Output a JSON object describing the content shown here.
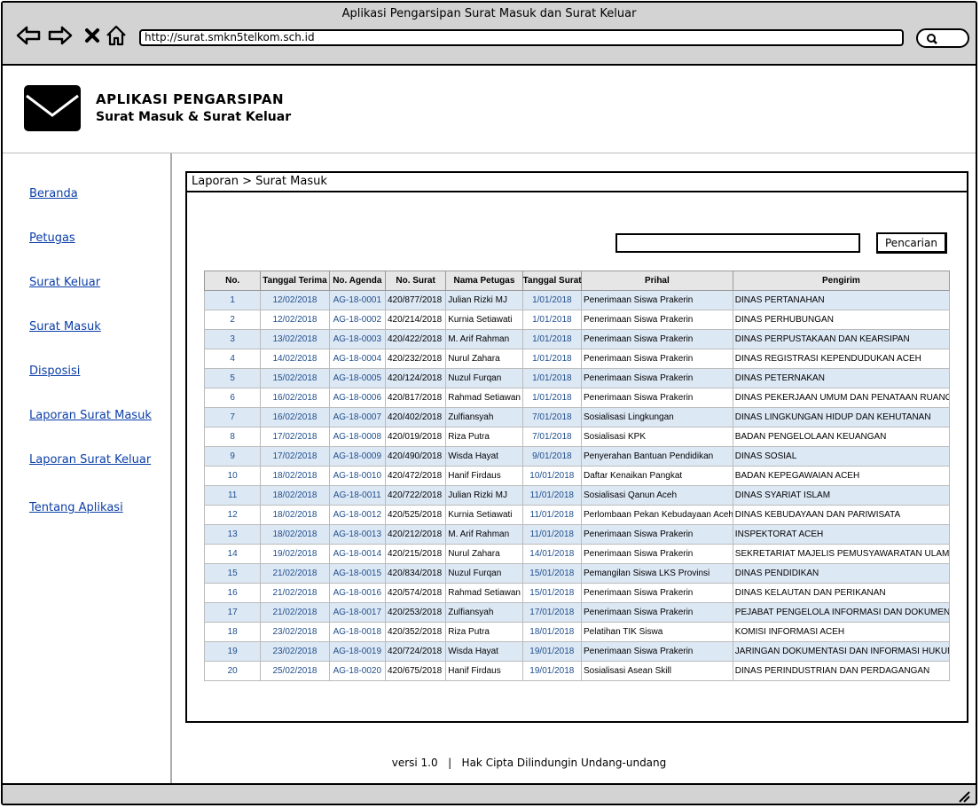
{
  "window": {
    "title": "Aplikasi Pengarsipan Surat Masuk dan Surat Keluar"
  },
  "browser": {
    "url": "http://surat.smkn5telkom.sch.id"
  },
  "app": {
    "title": "APLIKASI PENGARSIPAN",
    "subtitle": "Surat Masuk & Surat Keluar"
  },
  "sidebar": {
    "items": [
      {
        "label": "Beranda"
      },
      {
        "label": "Petugas"
      },
      {
        "label": "Surat Keluar"
      },
      {
        "label": "Surat Masuk"
      },
      {
        "label": "Disposisi"
      },
      {
        "label": "Laporan Surat Masuk"
      },
      {
        "label": "Laporan Surat Keluar"
      },
      {
        "label": "Tentang Aplikasi"
      }
    ]
  },
  "main": {
    "breadcrumb": "Laporan > Surat Masuk",
    "search": {
      "value": "",
      "button": "Pencarian"
    },
    "table": {
      "columns": [
        "No.",
        "Tanggal Terima",
        "No. Agenda",
        "No. Surat",
        "Nama Petugas",
        "Tanggal Surat",
        "Prihal",
        "Pengirim"
      ],
      "rows": [
        [
          "1",
          "12/02/2018",
          "AG-18-0001",
          "420/877/2018",
          "Julian Rizki MJ",
          "1/01/2018",
          "Penerimaan Siswa Prakerin",
          "DINAS PERTANAHAN"
        ],
        [
          "2",
          "12/02/2018",
          "AG-18-0002",
          "420/214/2018",
          "Kurnia Setiawati",
          "1/01/2018",
          "Penerimaan Siswa Prakerin",
          "DINAS PERHUBUNGAN"
        ],
        [
          "3",
          "13/02/2018",
          "AG-18-0003",
          "420/422/2018",
          "M. Arif Rahman",
          "1/01/2018",
          "Penerimaan Siswa Prakerin",
          "DINAS PERPUSTAKAAN DAN KEARSIPAN"
        ],
        [
          "4",
          "14/02/2018",
          "AG-18-0004",
          "420/232/2018",
          "Nurul Zahara",
          "1/01/2018",
          "Penerimaan Siswa Prakerin",
          "DINAS REGISTRASI KEPENDUDUKAN ACEH"
        ],
        [
          "5",
          "15/02/2018",
          "AG-18-0005",
          "420/124/2018",
          "Nuzul Furqan",
          "1/01/2018",
          "Penerimaan Siswa Prakerin",
          "DINAS PETERNAKAN"
        ],
        [
          "6",
          "16/02/2018",
          "AG-18-0006",
          "420/817/2018",
          "Rahmad Setiawan",
          "1/01/2018",
          "Penerimaan Siswa Prakerin",
          "DINAS PEKERJAAN UMUM DAN PENATAAN RUANG"
        ],
        [
          "7",
          "16/02/2018",
          "AG-18-0007",
          "420/402/2018",
          "Zulfiansyah",
          "7/01/2018",
          "Sosialisasi Lingkungan",
          "DINAS LINGKUNGAN HIDUP DAN KEHUTANAN"
        ],
        [
          "8",
          "17/02/2018",
          "AG-18-0008",
          "420/019/2018",
          "Riza Putra",
          "7/01/2018",
          "Sosialisasi KPK",
          "BADAN PENGELOLAAN KEUANGAN"
        ],
        [
          "9",
          "17/02/2018",
          "AG-18-0009",
          "420/490/2018",
          "Wisda Hayat",
          "9/01/2018",
          "Penyerahan Bantuan Pendidikan",
          "DINAS SOSIAL"
        ],
        [
          "10",
          "18/02/2018",
          "AG-18-0010",
          "420/472/2018",
          "Hanif Firdaus",
          "10/01/2018",
          "Daftar Kenaikan Pangkat",
          "BADAN KEPEGAWAIAN ACEH"
        ],
        [
          "11",
          "18/02/2018",
          "AG-18-0011",
          "420/722/2018",
          "Julian Rizki MJ",
          "11/01/2018",
          "Sosialisasi Qanun Aceh",
          "DINAS SYARIAT ISLAM"
        ],
        [
          "12",
          "18/02/2018",
          "AG-18-0012",
          "420/525/2018",
          "Kurnia Setiawati",
          "11/01/2018",
          "Perlombaan Pekan Kebudayaan Aceh",
          "DINAS KEBUDAYAAN DAN PARIWISATA"
        ],
        [
          "13",
          "18/02/2018",
          "AG-18-0013",
          "420/212/2018",
          "M. Arif Rahman",
          "11/01/2018",
          "Penerimaan Siswa Prakerin",
          "INSPEKTORAT ACEH"
        ],
        [
          "14",
          "19/02/2018",
          "AG-18-0014",
          "420/215/2018",
          "Nurul Zahara",
          "14/01/2018",
          "Penerimaan Siswa Prakerin",
          "SEKRETARIAT MAJELIS PEMUSYAWARATAN ULAMA"
        ],
        [
          "15",
          "21/02/2018",
          "AG-18-0015",
          "420/834/2018",
          "Nuzul Furqan",
          "15/01/2018",
          "Pemangilan Siswa LKS Provinsi",
          "DINAS PENDIDIKAN"
        ],
        [
          "16",
          "21/02/2018",
          "AG-18-0016",
          "420/574/2018",
          "Rahmad Setiawan",
          "15/01/2018",
          "Penerimaan Siswa Prakerin",
          "DINAS KELAUTAN DAN PERIKANAN"
        ],
        [
          "17",
          "21/02/2018",
          "AG-18-0017",
          "420/253/2018",
          "Zulfiansyah",
          "17/01/2018",
          "Penerimaan Siswa Prakerin",
          "PEJABAT PENGELOLA INFORMASI DAN DOKUMENTASI"
        ],
        [
          "18",
          "23/02/2018",
          "AG-18-0018",
          "420/352/2018",
          "Riza Putra",
          "18/01/2018",
          "Pelatihan TIK Siswa",
          "KOMISI INFORMASI ACEH"
        ],
        [
          "19",
          "23/02/2018",
          "AG-18-0019",
          "420/724/2018",
          "Wisda Hayat",
          "19/01/2018",
          "Penerimaan Siswa Prakerin",
          "JARINGAN DOKUMENTASI DAN INFORMASI HUKUM"
        ],
        [
          "20",
          "25/02/2018",
          "AG-18-0020",
          "420/675/2018",
          "Hanif Firdaus",
          "19/01/2018",
          "Sosialisasi Asean Skill",
          "DINAS PERINDUSTRIAN DAN PERDAGANGAN"
        ]
      ]
    }
  },
  "footer": {
    "text": "versi 1.0   |   Hak Cipta Dilindungin Undang-undang"
  },
  "icons": [
    "back-arrow-icon",
    "forward-arrow-icon",
    "close-icon",
    "home-icon",
    "search-icon",
    "mail-logo-icon",
    "resize-grip-icon"
  ],
  "colors": {
    "link": "#0b3ea8",
    "row_alt": "#dde8f5",
    "chrome": "#d3d3d3",
    "cell_blue": "#1f4e8c"
  }
}
